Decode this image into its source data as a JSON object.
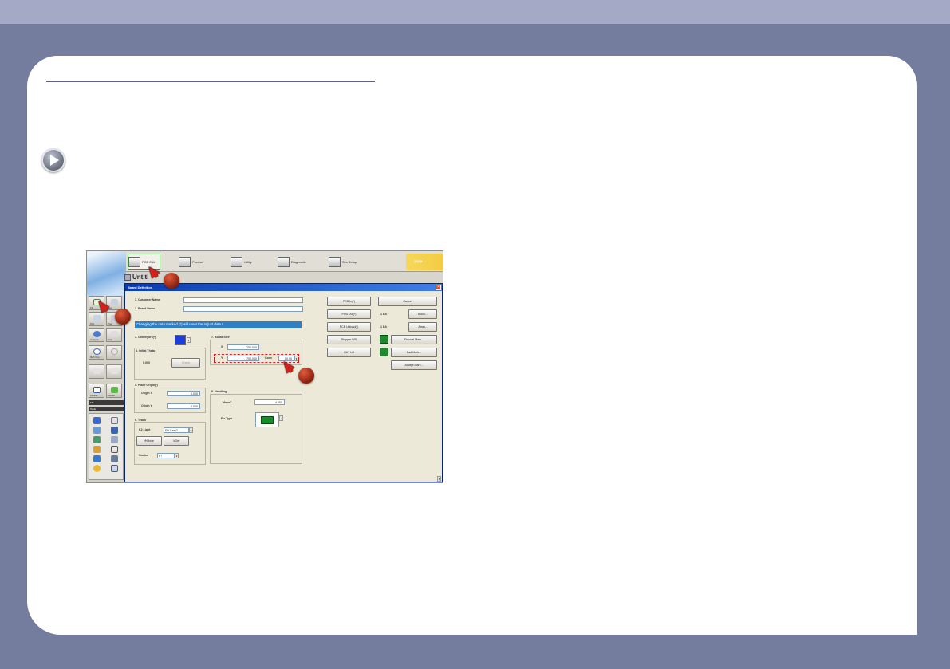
{
  "app": {
    "tabs": [
      {
        "label": "PCB Edit",
        "active": true
      },
      {
        "label": "Product"
      },
      {
        "label": "Utility"
      },
      {
        "label": "Diagnostic"
      },
      {
        "label": "Sys Setup"
      }
    ],
    "status": {
      "arrows": ">>>",
      "state": "IDLE"
    },
    "document_title": "Untitl"
  },
  "sidebar": {
    "cells": [
      {
        "label": "Fil"
      },
      {
        "label": "Nav"
      },
      {
        "label": "Pos"
      },
      {
        "label": "Pos"
      },
      {
        "label": "Analyze"
      },
      {
        "label": "Stop"
      },
      {
        "label": "Ref Chip"
      },
      {
        "label": ""
      },
      {
        "label": ""
      },
      {
        "label": ""
      },
      {
        "label": "Cancel"
      },
      {
        "label": "Layout"
      }
    ],
    "headers": [
      "File",
      "Tools"
    ]
  },
  "dialog": {
    "title": "Board Definition",
    "fields": {
      "customer_name": {
        "label": "1. Customer Name",
        "value": ""
      },
      "board_name": {
        "label": "2. Board Name",
        "value": ""
      }
    },
    "warning": "Changing the data marked (*) will reset the adjust data !",
    "conveyor": {
      "label": "3. Conveyors(*)"
    },
    "initial_theta": {
      "label": "4. Initial Theta",
      "value": "0.000",
      "button": "Check"
    },
    "place_origin": {
      "label": "5. Place Origin(*)",
      "x_label": "Origin X",
      "x_value": "0.000",
      "y_label": "Origin Y",
      "y_value": "0.000"
    },
    "teach": {
      "label": "6. Teach",
      "light_label": "K2 Light",
      "light_value": "Fid Cam2",
      "move": "Move",
      "get": "Get",
      "station_label": "Station",
      "station_value": "F7"
    },
    "board_size": {
      "label": "7. Board Size",
      "x_label": "X",
      "x_value": "700.000",
      "y_label": "Y",
      "y_value": "700.000",
      "conv_label": "Conv",
      "conv_value": "50.00"
    },
    "handling": {
      "label": "8. Handling",
      "move_z_label": "MoveZ",
      "move_z_value": "4.000",
      "fix_type_label": "Fix Type"
    },
    "buttons": {
      "pcb_in": "PCB In(*)",
      "pcb_out": "PCB Out(*)",
      "pcb_unload": "PCB Unload(*)",
      "stopper_wd": "Stopper WD",
      "out_lift": "OUT Lift",
      "cancel": "Cancel",
      "block_count": "1 EA",
      "block": "Block...",
      "array_count": "1 EA",
      "array": "Array...",
      "fiducial_mark": "Fiducial Mark...",
      "bad_mark": "Bad Mark...",
      "accept_mark": "Accept Mark..."
    }
  },
  "colors": {
    "frame": "#757d9f",
    "top_strip": "#a4aac6",
    "idle": "#f2c02c",
    "marker": "#8a1f0e",
    "warning": "#2f7fc8",
    "dialog_title": "#0a3ab0",
    "conveyor_swatch": "#1b3de0",
    "green_indicator": "#1a8c2a"
  },
  "icons": [
    "play-circle-icon",
    "mouse-cursor-icon",
    "step-marker-icon"
  ]
}
